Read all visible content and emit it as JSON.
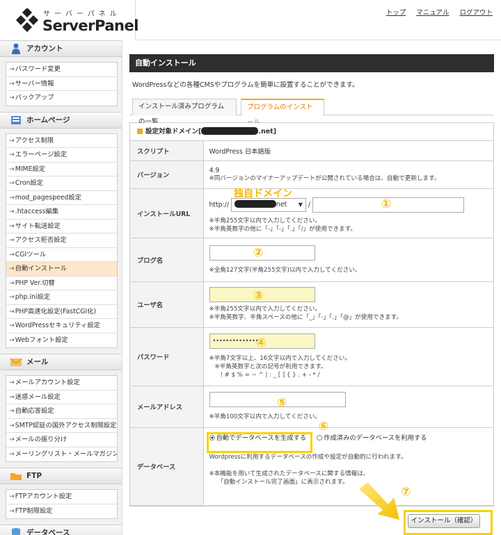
{
  "header": {
    "logo_kana": "サーバーパネル",
    "logo_text": "ServerPanel",
    "links": [
      "トップ",
      "マニュアル",
      "ログアウト"
    ]
  },
  "sidebar": {
    "sections": [
      {
        "title": "アカウント",
        "icon": "person-icon",
        "items": [
          "パスワード変更",
          "サーバー情報",
          "バックアップ"
        ]
      },
      {
        "title": "ホームページ",
        "icon": "book-icon",
        "items": [
          "アクセス制限",
          "エラーページ設定",
          "MIME設定",
          "Cron設定",
          "mod_pagespeed設定",
          ".htaccess編集",
          "サイト転送設定",
          "アクセス拒否設定",
          "CGIツール",
          "自動インストール",
          "PHP Ver.切替",
          "php.ini設定",
          "PHP高速化設定(FastCGI化)",
          "WordPressセキュリティ設定",
          "Webフォント設定"
        ],
        "active_index": 9
      },
      {
        "title": "メール",
        "icon": "envelope-icon",
        "items": [
          "メールアカウント設定",
          "迷惑メール設定",
          "自動応答設定",
          "SMTP認証の国外アクセス制限設定",
          "メールの振り分け",
          "メーリングリスト・メールマガジン"
        ]
      },
      {
        "title": "FTP",
        "icon": "folder-icon",
        "items": [
          "FTPアカウント設定",
          "FTP制限設定"
        ]
      },
      {
        "title": "データベース",
        "icon": "database-icon",
        "items": []
      }
    ]
  },
  "main": {
    "title": "自動インストール",
    "description": "WordPressなどの各種CMSやプログラムを簡単に設置することができます。",
    "tabs": [
      "インストール済みプログラムの一覧",
      "プログラムのインストール"
    ],
    "domain_prefix": "設定対象ドメイン[",
    "domain_suffix": ".net]",
    "rows": {
      "script": {
        "label": "スクリプト",
        "value": "WordPress 日本語版"
      },
      "version": {
        "label": "バージョン",
        "value": "4.9",
        "note": "※同バージョンのマイナーアップデートが公開されている場合は、自動で更新します。"
      },
      "url": {
        "label": "インストールURL",
        "prefix": "http://",
        "select_suffix": "net",
        "slash": "/",
        "note1": "※半角255文字以内で入力してください。",
        "note2": "※半角英数字の他に「-」「-」「.」「/」が使用できます。"
      },
      "blog": {
        "label": "ブログ名",
        "note": "※全角127文字(半角255文字)以内で入力してください。"
      },
      "user": {
        "label": "ユーザ名",
        "note1": "※半角255文字以内で入力してください。",
        "note2": "※半角英数字、半角スペースの他に「_」「-」「.」「@」が使用できます。"
      },
      "password": {
        "label": "パスワード",
        "value": "••••••••••••••",
        "note1": "※半角7文字以上、16文字以内で入力してください。",
        "note2": "※半角英数字と次の記号が利用できます。",
        "symbols": "! # $ % = ~ ^ | : _ [ ] { } . + - * /"
      },
      "email": {
        "label": "メールアドレス",
        "note": "※半角100文字以内で入力してください。"
      },
      "database": {
        "label": "データベース",
        "option1": "自動でデータベースを生成する",
        "option2": "作成済みのデータベースを利用する",
        "note1": "Wordpressに利用するデータベースの作成や設定が自動的に行われます。",
        "note2": "※本機能を用いて生成されたデータベースに関する情報は、",
        "note3": "「自動インストール完了画面」に表示されます。"
      }
    },
    "install_button": "インストール（確認）"
  },
  "annotations": {
    "domain_label": "独自ドメイン",
    "numbers": [
      "①",
      "②",
      "③",
      "④",
      "⑤",
      "⑥",
      "⑦"
    ],
    "highlight_color": "#f7d300"
  }
}
